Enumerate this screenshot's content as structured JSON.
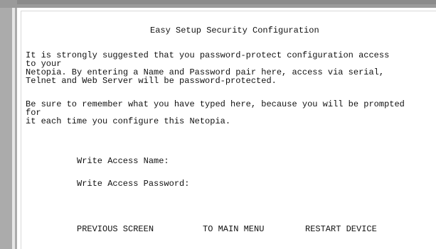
{
  "screen": {
    "title": "Easy Setup Security Configuration",
    "paragraph1": [
      "It is strongly suggested that you password-protect configuration access",
      "to your",
      "Netopia. By entering a Name and Password pair here, access via serial,",
      "Telnet and Web Server will be password-protected."
    ],
    "paragraph2": [
      "Be sure to remember what you have typed here, because you will be prompted",
      "for",
      "it each time you configure this Netopia."
    ]
  },
  "fields": {
    "write_access_name_label": "Write Access Name:",
    "write_access_password_label": "Write Access Password:"
  },
  "navigation": {
    "previous_label": "PREVIOUS SCREEN",
    "main_menu_label": "TO MAIN MENU",
    "restart_label": "RESTART DEVICE"
  }
}
